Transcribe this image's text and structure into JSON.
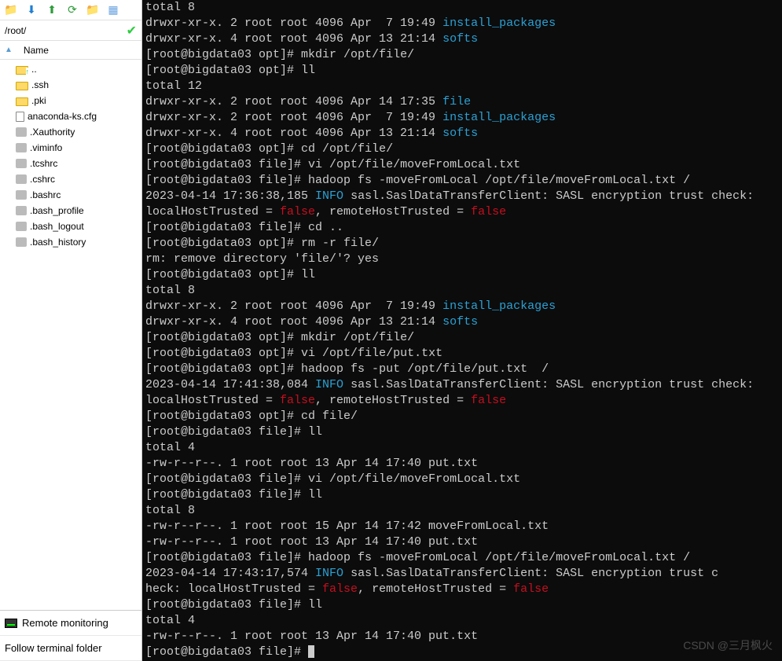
{
  "toolbar": {
    "icons": [
      "folder-up-icon",
      "download-icon",
      "upload-icon",
      "refresh-icon",
      "new-folder-icon",
      "properties-icon"
    ]
  },
  "path": {
    "value": "/root/",
    "status": "ok"
  },
  "header": {
    "name_label": "Name"
  },
  "files": [
    {
      "name": "..",
      "type": "folder-up"
    },
    {
      "name": ".ssh",
      "type": "folder"
    },
    {
      "name": ".pki",
      "type": "folder"
    },
    {
      "name": "anaconda-ks.cfg",
      "type": "file"
    },
    {
      "name": ".Xauthority",
      "type": "gear"
    },
    {
      "name": ".viminfo",
      "type": "gear"
    },
    {
      "name": ".tcshrc",
      "type": "gear"
    },
    {
      "name": ".cshrc",
      "type": "gear"
    },
    {
      "name": ".bashrc",
      "type": "gear"
    },
    {
      "name": ".bash_profile",
      "type": "gear"
    },
    {
      "name": ".bash_logout",
      "type": "gear"
    },
    {
      "name": ".bash_history",
      "type": "gear"
    }
  ],
  "bottom": {
    "remote_monitoring": "Remote monitoring",
    "follow_terminal": "Follow terminal folder"
  },
  "watermark": "CSDN @三月枫火",
  "terminal": [
    {
      "t": "plain",
      "s": "total 8"
    },
    {
      "t": "ls",
      "perm": "drwxr-xr-x. 2 root root 4096 Apr  7 19:49 ",
      "name": "install_packages",
      "cls": "cyan"
    },
    {
      "t": "ls",
      "perm": "drwxr-xr-x. 4 root root 4096 Apr 13 21:14 ",
      "name": "softs",
      "cls": "cyan"
    },
    {
      "t": "prompt",
      "host": "[root@bigdata03 opt]# ",
      "cmd": "mkdir /opt/file/"
    },
    {
      "t": "prompt",
      "host": "[root@bigdata03 opt]# ",
      "cmd": "ll"
    },
    {
      "t": "plain",
      "s": "total 12"
    },
    {
      "t": "ls",
      "perm": "drwxr-xr-x. 2 root root 4096 Apr 14 17:35 ",
      "name": "file",
      "cls": "cyan"
    },
    {
      "t": "ls",
      "perm": "drwxr-xr-x. 2 root root 4096 Apr  7 19:49 ",
      "name": "install_packages",
      "cls": "cyan"
    },
    {
      "t": "ls",
      "perm": "drwxr-xr-x. 4 root root 4096 Apr 13 21:14 ",
      "name": "softs",
      "cls": "cyan"
    },
    {
      "t": "prompt",
      "host": "[root@bigdata03 opt]# ",
      "cmd": "cd /opt/file/"
    },
    {
      "t": "prompt",
      "host": "[root@bigdata03 file]# ",
      "cmd": "vi /opt/file/moveFromLocal.txt"
    },
    {
      "t": "prompt",
      "host": "[root@bigdata03 file]# ",
      "cmd": "hadoop fs -moveFromLocal /opt/file/moveFromLocal.txt /"
    },
    {
      "t": "sasl",
      "pre": "2023-04-14 17:36:38,185 ",
      "info": "INFO",
      "mid": " sasl.SaslDataTransferClient: SASL encryption trust check: localHostTrusted = ",
      "f1": "false",
      "mid2": ", remoteHostTrusted = ",
      "f2": "false"
    },
    {
      "t": "prompt",
      "host": "[root@bigdata03 file]# ",
      "cmd": "cd .."
    },
    {
      "t": "prompt",
      "host": "[root@bigdata03 opt]# ",
      "cmd": "rm -r file/"
    },
    {
      "t": "plain",
      "s": "rm: remove directory 'file/'? yes"
    },
    {
      "t": "prompt",
      "host": "[root@bigdata03 opt]# ",
      "cmd": "ll"
    },
    {
      "t": "plain",
      "s": "total 8"
    },
    {
      "t": "ls",
      "perm": "drwxr-xr-x. 2 root root 4096 Apr  7 19:49 ",
      "name": "install_packages",
      "cls": "cyan"
    },
    {
      "t": "ls",
      "perm": "drwxr-xr-x. 4 root root 4096 Apr 13 21:14 ",
      "name": "softs",
      "cls": "cyan"
    },
    {
      "t": "prompt",
      "host": "[root@bigdata03 opt]# ",
      "cmd": "mkdir /opt/file/"
    },
    {
      "t": "prompt",
      "host": "[root@bigdata03 opt]# ",
      "cmd": "vi /opt/file/put.txt"
    },
    {
      "t": "prompt",
      "host": "[root@bigdata03 opt]# ",
      "cmd": "hadoop fs -put /opt/file/put.txt  /"
    },
    {
      "t": "sasl",
      "pre": "2023-04-14 17:41:38,084 ",
      "info": "INFO",
      "mid": " sasl.SaslDataTransferClient: SASL encryption trust check: localHostTrusted = ",
      "f1": "false",
      "mid2": ", remoteHostTrusted = ",
      "f2": "false"
    },
    {
      "t": "prompt",
      "host": "[root@bigdata03 opt]# ",
      "cmd": "cd file/"
    },
    {
      "t": "prompt",
      "host": "[root@bigdata03 file]# ",
      "cmd": "ll"
    },
    {
      "t": "plain",
      "s": "total 4"
    },
    {
      "t": "plain",
      "s": "-rw-r--r--. 1 root root 13 Apr 14 17:40 put.txt"
    },
    {
      "t": "prompt",
      "host": "[root@bigdata03 file]# ",
      "cmd": "vi /opt/file/moveFromLocal.txt"
    },
    {
      "t": "prompt",
      "host": "[root@bigdata03 file]# ",
      "cmd": "ll"
    },
    {
      "t": "plain",
      "s": "total 8"
    },
    {
      "t": "plain",
      "s": "-rw-r--r--. 1 root root 15 Apr 14 17:42 moveFromLocal.txt"
    },
    {
      "t": "plain",
      "s": "-rw-r--r--. 1 root root 13 Apr 14 17:40 put.txt"
    },
    {
      "t": "prompt",
      "host": "[root@bigdata03 file]# ",
      "cmd": "hadoop fs -moveFromLocal /opt/file/moveFromLocal.txt /"
    },
    {
      "t": "sasl",
      "pre": "2023-04-14 17:43:17,574 ",
      "info": "INFO",
      "mid": " sasl.SaslDataTransferClient: SASL encryption trust c\nheck: localHostTrusted = ",
      "f1": "false",
      "mid2": ", remoteHostTrusted = ",
      "f2": "false"
    },
    {
      "t": "prompt",
      "host": "[root@bigdata03 file]# ",
      "cmd": "ll"
    },
    {
      "t": "plain",
      "s": "total 4"
    },
    {
      "t": "plain",
      "s": "-rw-r--r--. 1 root root 13 Apr 14 17:40 put.txt"
    },
    {
      "t": "prompt",
      "host": "[root@bigdata03 file]# ",
      "cmd": "",
      "cursor": true
    }
  ]
}
